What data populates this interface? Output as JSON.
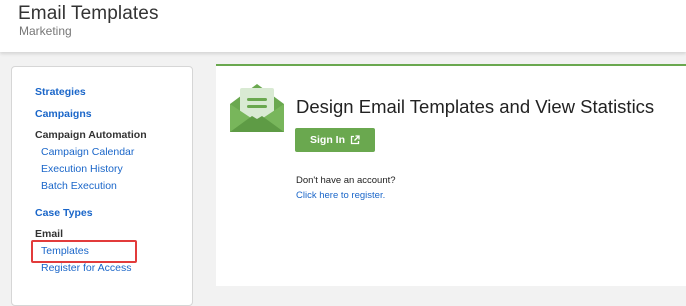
{
  "header": {
    "title": "Email Templates",
    "subtitle": "Marketing"
  },
  "sidebar": {
    "strategies": "Strategies",
    "campaigns": "Campaigns",
    "campaign_automation": {
      "heading": "Campaign Automation",
      "items": [
        "Campaign Calendar",
        "Execution History",
        "Batch Execution"
      ]
    },
    "case_types": "Case Types",
    "email": {
      "heading": "Email",
      "items": [
        "Templates",
        "Register for Access"
      ],
      "highlighted_item": "Templates"
    }
  },
  "main": {
    "icon": "envelope-icon",
    "title": "Design Email Templates and View Statistics",
    "signin_label": "Sign In",
    "signin_icon": "external-link-icon",
    "no_account_text": "Don't have an account?",
    "register_link": "Click here to register."
  },
  "colors": {
    "accent_green": "#6aa84f",
    "link_blue": "#1a66c9",
    "highlight_red": "#e23b3b"
  }
}
